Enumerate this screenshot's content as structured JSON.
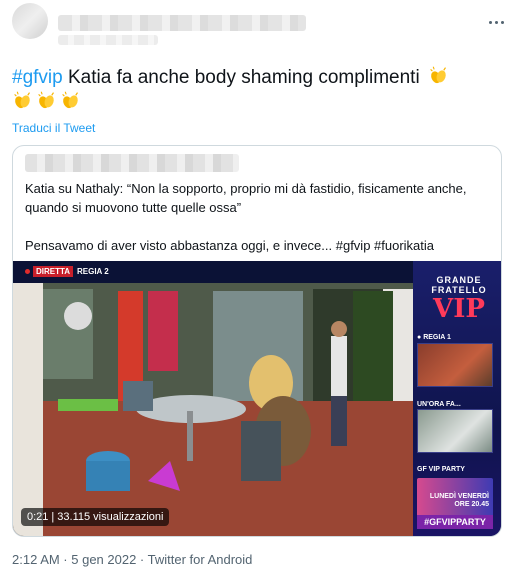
{
  "tweet": {
    "hashtag": "#gfvip",
    "text": " Katia fa anche body shaming complimenti",
    "emoji": "clapping-hands",
    "translate_label": "Traduci il Tweet",
    "footer": "2:12 AM · 5 gen 2022 · Twitter for Android"
  },
  "quoted": {
    "line1": "Katia su Nathaly: “Non la sopporto, proprio mi dà fastidio, fisicamente anche, quando si muovono tutte quelle ossa”",
    "line2": "Pensavamo di aver visto abbastanza oggi, e invece... #gfvip #fuorikatia"
  },
  "video": {
    "diretta": "DIRETTA",
    "regia": "REGIA 2",
    "logo_line1": "GRANDE",
    "logo_line2": "FRATELLO",
    "logo_line3": "VIP",
    "side_regia": "REGIA 1",
    "side_unora": "UN'ORA FA...",
    "side_party": "GF VIP PARTY",
    "side_days": "LUNEDÌ VENERDÌ",
    "side_hour": "ORE 20.45",
    "side_tag": "#GFVIPPARTY",
    "time": "0:21",
    "views": "33.115 visualizzazioni"
  },
  "colors": {
    "link": "#1d9bf0",
    "muted": "#536471",
    "border": "#cfd9de"
  }
}
